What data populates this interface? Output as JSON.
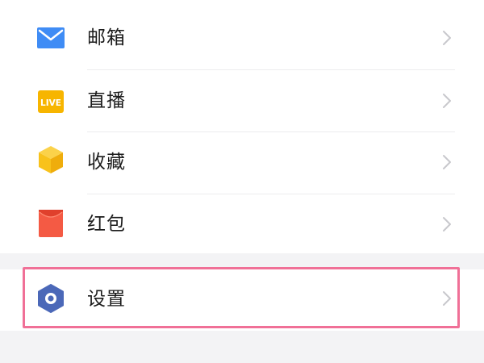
{
  "menu": {
    "items": [
      {
        "label": "邮箱",
        "icon": "mail-icon",
        "color": "#3f8cf5"
      },
      {
        "label": "直播",
        "icon": "live-icon",
        "color": "#f7b500",
        "badge": "LIVE"
      },
      {
        "label": "收藏",
        "icon": "favorites-cube-icon",
        "color": "#f8c21b"
      },
      {
        "label": "红包",
        "icon": "red-packet-icon",
        "color": "#f45a44"
      }
    ],
    "settings": {
      "label": "设置",
      "icon": "settings-hexagon-icon",
      "color": "#4b68b8"
    }
  },
  "colors": {
    "page_bg": "#f3f3f5",
    "card_bg": "#ffffff",
    "highlight": "#f07097",
    "chevron": "#c8c8cc"
  }
}
